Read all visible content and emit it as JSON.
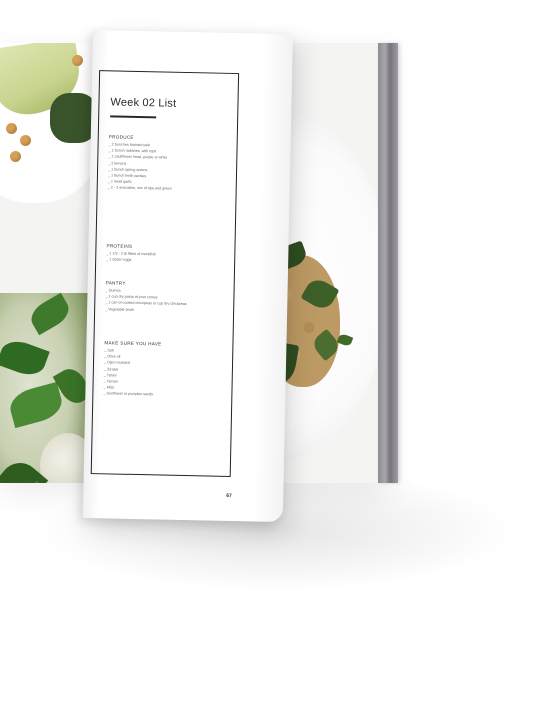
{
  "page": {
    "title": "Week 02 List",
    "page_number": "67",
    "sections": [
      {
        "heading": "PRODUCE",
        "items": [
          "_ 2 bunches lacinato kale",
          "_ 1 bunch radishes, with tops",
          "_ 1 cauliflower head, purple or white",
          "_ 2 lemons",
          "_ 1 bunch spring onions",
          "_ 1 bunch fresh parsley",
          "_ 1 head garlic",
          "_ 2 - 3 avocados, mix of ripe and green"
        ]
      },
      {
        "heading": "PROTEINS",
        "items": [
          "_ 1 1/2 - 2 lb fillets of monkfish",
          "_ 1 dozen eggs"
        ]
      },
      {
        "heading": "PANTRY",
        "items": [
          "_ Quinoa",
          "_ 1 cup dry pasta of your choice",
          "_ 1 can of cooked chickpeas or cup dry chickpeas",
          "_ Vegetable broth"
        ]
      },
      {
        "heading": "MAKE SURE YOU HAVE",
        "items": [
          "_ Salt",
          "_ Olive oil",
          "_ Dijon mustard",
          "_ Za'atar",
          "_ Tahini",
          "_ Tamari",
          "_ Miso",
          "_ Sunflower or pumpkin seeds"
        ]
      }
    ]
  },
  "colors": {
    "page_edge": "#8d8b90",
    "frame": "#222222",
    "kale": "#2f4d22",
    "quinoa": "#bd9a63"
  }
}
